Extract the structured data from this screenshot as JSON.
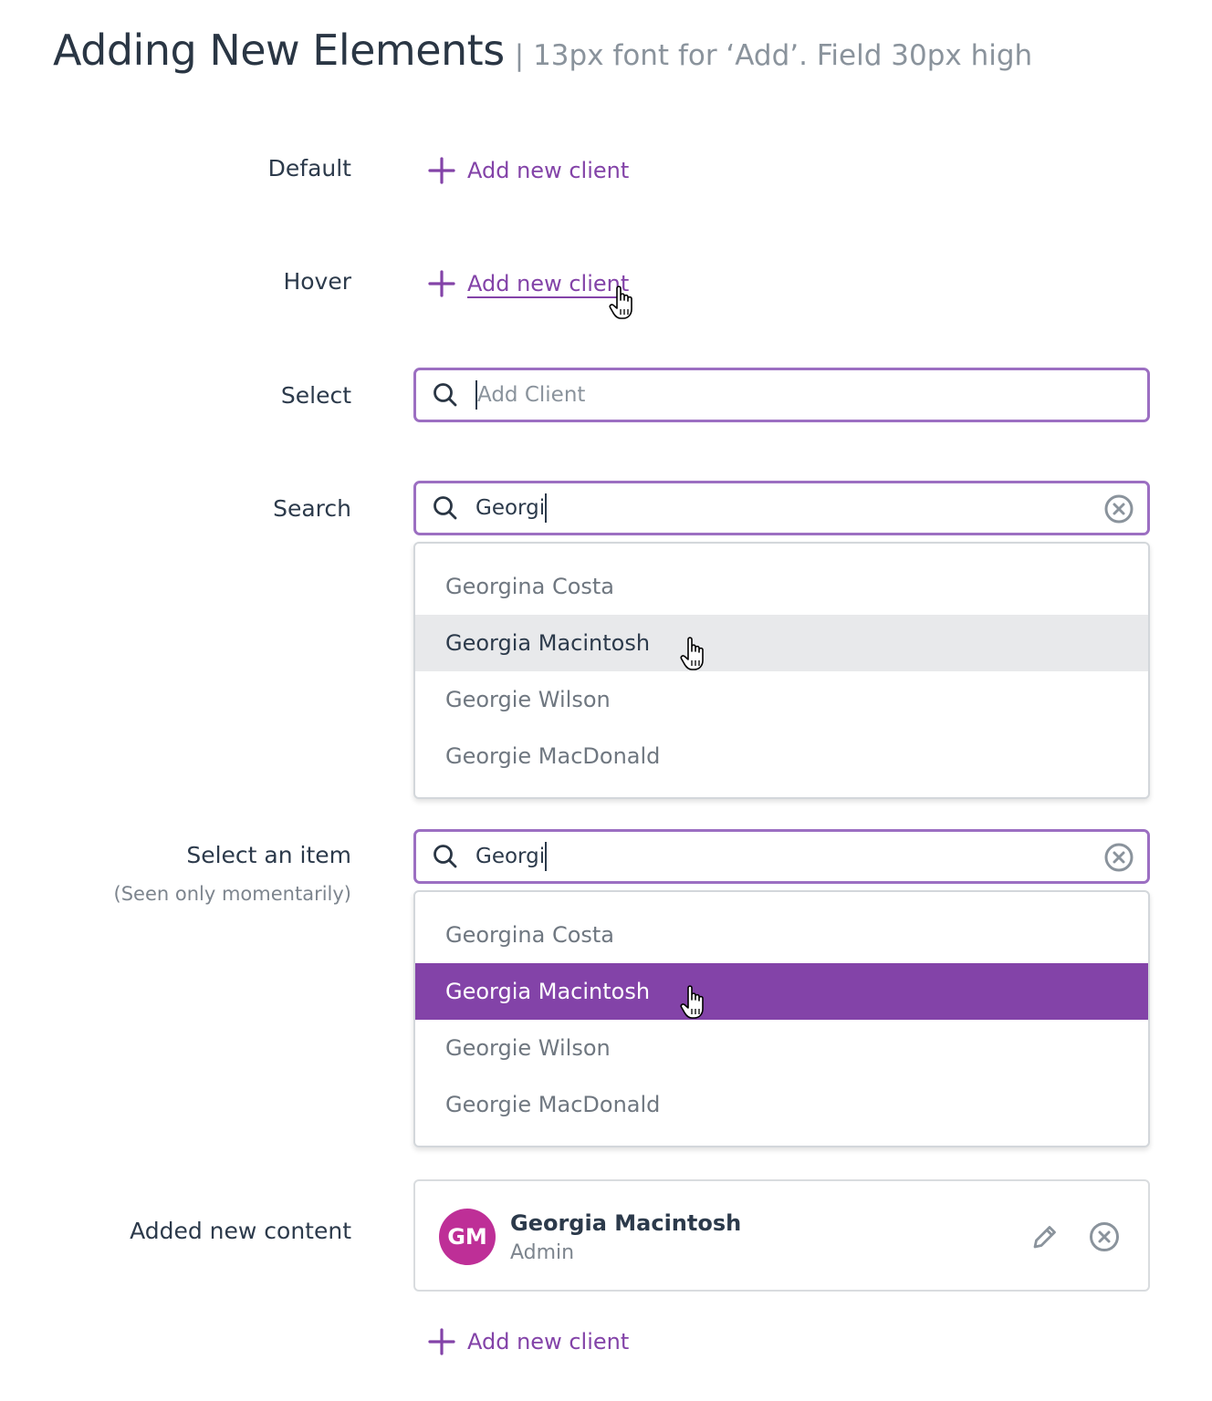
{
  "header": {
    "title": "Adding New Elements",
    "subtitle": "| 13px font for ‘Add’. Field 30px high"
  },
  "colors": {
    "accent": "#8343a8",
    "field_border": "#9c6fc2",
    "avatar": "#be2f97",
    "hover_row": "#e8e9eb"
  },
  "rows": {
    "default": {
      "label": "Default",
      "link": "Add new client"
    },
    "hover": {
      "label": "Hover",
      "link": "Add new client"
    },
    "select": {
      "label": "Select",
      "placeholder": "Add Client"
    },
    "search": {
      "label": "Search",
      "value": "Georgi",
      "options": [
        "Georgina Costa",
        "Georgia Macintosh",
        "Georgie Wilson",
        "Georgie MacDonald"
      ],
      "hovered_option": "Georgia Macintosh"
    },
    "select_item": {
      "label": "Select an item",
      "sublabel": "(Seen only momentarily)",
      "value": "Georgi",
      "options": [
        "Georgina Costa",
        "Georgia Macintosh",
        "Georgie Wilson",
        "Georgie MacDonald"
      ],
      "selected_option": "Georgia Macintosh"
    },
    "added": {
      "label": "Added new content",
      "avatar_initials": "GM",
      "name": "Georgia Macintosh",
      "role": "Admin",
      "link": "Add new client"
    }
  },
  "icons": [
    "plus-icon",
    "pointer-hand-icon",
    "search-icon",
    "clear-icon",
    "pencil-icon",
    "remove-icon"
  ]
}
